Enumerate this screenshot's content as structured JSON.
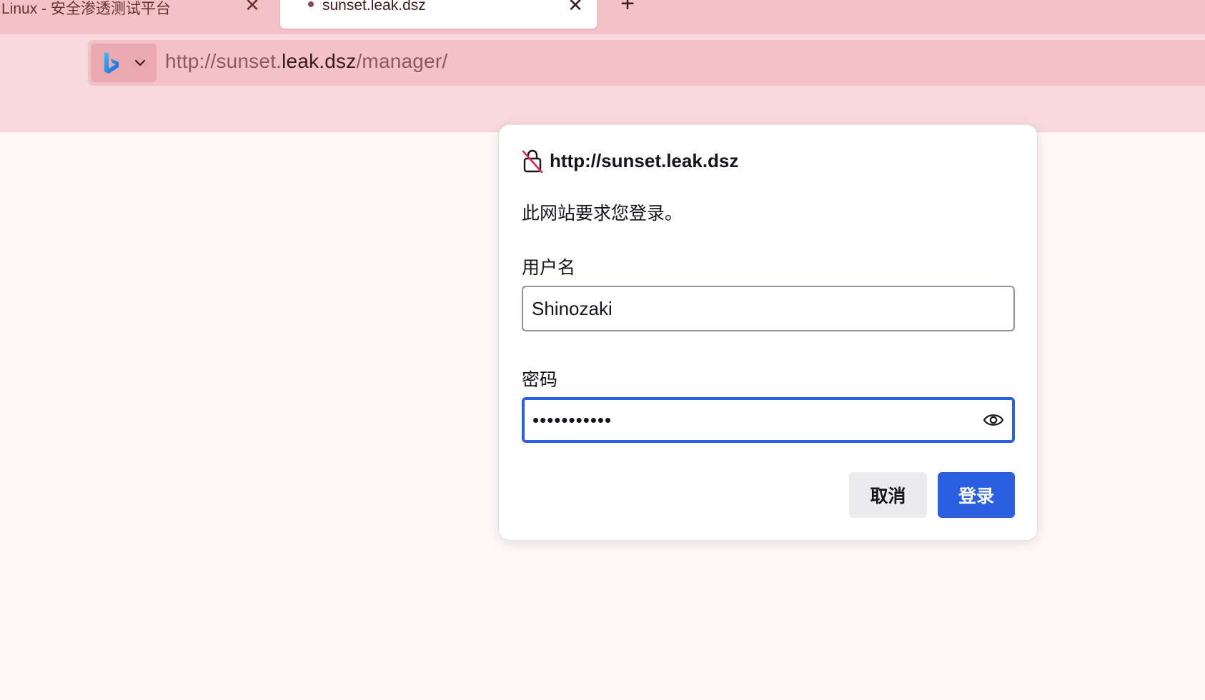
{
  "tabs": [
    {
      "title": "Linux - 安全渗透测试平台",
      "active": false
    },
    {
      "title": "sunset.leak.dsz",
      "active": true
    }
  ],
  "address_bar": {
    "search_engine": "bing-icon",
    "url_prefix": "http://sunset.",
    "url_host": "leak.dsz",
    "url_path": "/manager/"
  },
  "auth_dialog": {
    "origin": "http://sunset.leak.dsz",
    "message": "此网站要求您登录。",
    "username_label": "用户名",
    "username_value": "Shinozaki",
    "password_label": "密码",
    "password_masked": "•••••••••••",
    "cancel_label": "取消",
    "login_label": "登录"
  },
  "colors": {
    "tabstrip": "#f2c2c7",
    "toolbar": "#f8dadd",
    "primary_button": "#2a5fe0",
    "focus_ring": "#2a5fe0"
  }
}
